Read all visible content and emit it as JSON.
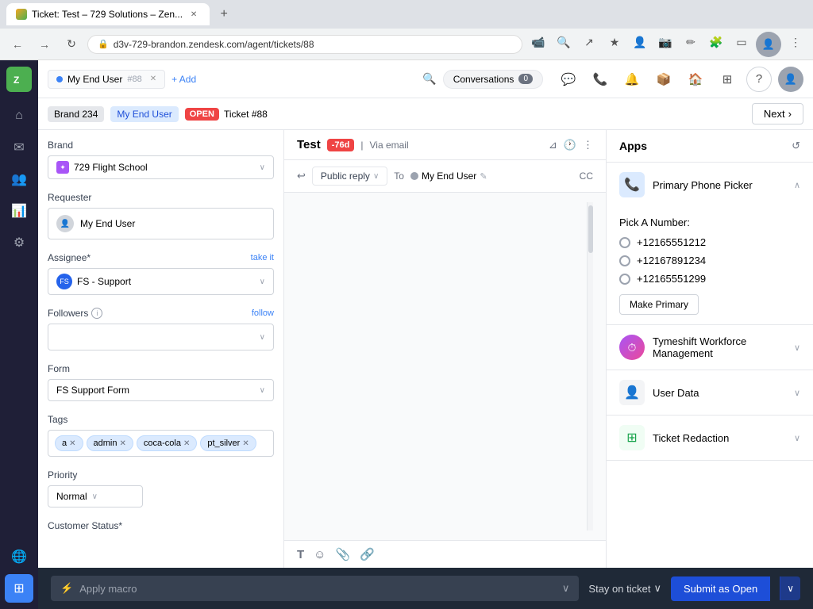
{
  "browser": {
    "tab_title": "Ticket: Test – 729 Solutions – Zen...",
    "url": "d3v-729-brandon.zendesk.com/agent/tickets/88",
    "new_tab_icon": "+"
  },
  "topbar": {
    "ticket_tab_user": "My End User",
    "ticket_tab_id": "#88",
    "add_label": "+ Add",
    "conversations_label": "Conversations",
    "conversations_count": "0"
  },
  "subnav": {
    "brand_label": "Brand 234",
    "user_label": "My End User",
    "status_label": "OPEN",
    "ticket_label": "Ticket #88",
    "next_label": "Next"
  },
  "left_panel": {
    "brand_label": "Brand",
    "brand_value": "729 Flight School",
    "requester_label": "Requester",
    "requester_value": "My End User",
    "assignee_label": "Assignee*",
    "assignee_take_it": "take it",
    "assignee_value": "FS - Support",
    "followers_label": "Followers",
    "followers_follow": "follow",
    "form_label": "Form",
    "form_value": "FS Support Form",
    "tags_label": "Tags",
    "tags": [
      "a",
      "admin",
      "coca-cola",
      "pt_silver"
    ],
    "priority_label": "Priority",
    "priority_value": "Normal",
    "customer_status_label": "Customer Status*"
  },
  "middle_panel": {
    "ticket_title": "Test",
    "age_badge": "-76d",
    "via_label": "Via email",
    "reply_btn_label": "Public reply",
    "to_label": "To",
    "to_user": "My End User",
    "cc_label": "CC"
  },
  "right_panel": {
    "apps_title": "Apps",
    "refresh_icon": "↺",
    "phone_picker_title": "Primary Phone Picker",
    "pick_number_label": "Pick A Number:",
    "phone_options": [
      "+12165551212",
      "+12167891234",
      "+12165551299"
    ],
    "make_primary_label": "Make Primary",
    "timeshift_title": "Tymeshift Workforce Management",
    "user_data_title": "User Data",
    "ticket_redaction_title": "Ticket Redaction"
  },
  "bottom_bar": {
    "macro_placeholder": "Apply macro",
    "stay_on_ticket": "Stay on ticket",
    "submit_label": "Submit as Open"
  },
  "icons": {
    "home": "⌂",
    "email": "✉",
    "users": "👥",
    "reports": "📊",
    "settings": "⚙",
    "globe": "🌐",
    "plugin": "🧩",
    "chat": "💬",
    "phone": "📞",
    "bell": "🔔",
    "box": "📦",
    "grid": "⊞",
    "help": "?",
    "filter": "⊿",
    "clock": "🕐",
    "more": "⋮",
    "back_arrow": "↩",
    "chevron_down": "∨",
    "chevron_right": ">",
    "bold": "B",
    "emoji": "☺",
    "attach": "📎",
    "link": "🔗",
    "camera": "📷",
    "star": "★",
    "extension": "🧩"
  }
}
